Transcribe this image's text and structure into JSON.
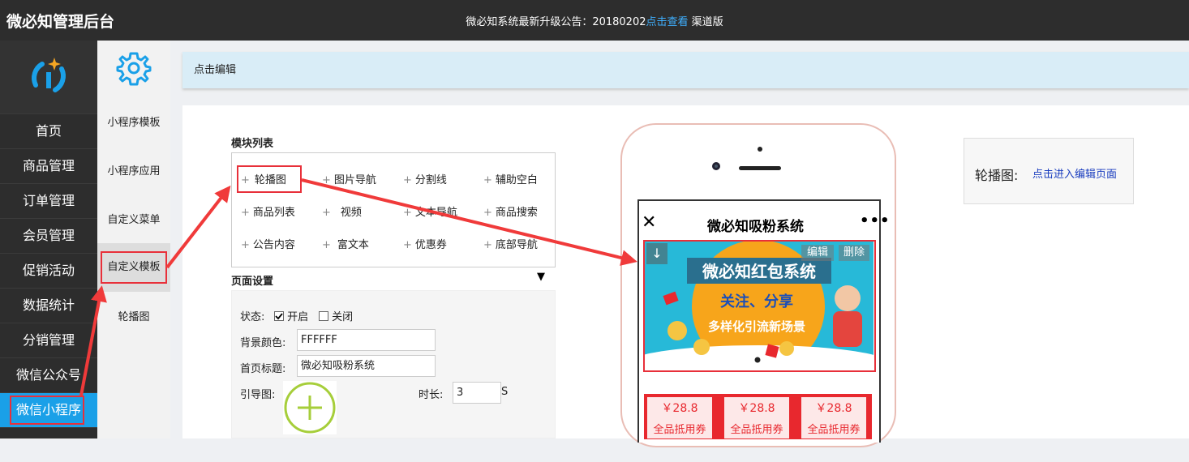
{
  "topbar": {
    "brand": "微必知管理后台",
    "notice_prefix": "微必知系统最新升级公告：20180202",
    "notice_link": "点击查看",
    "notice_suffix": " 渠道版"
  },
  "sidebar": {
    "items": [
      {
        "label": "首页"
      },
      {
        "label": "商品管理"
      },
      {
        "label": "订单管理"
      },
      {
        "label": "会员管理"
      },
      {
        "label": "促销活动"
      },
      {
        "label": "数据统计"
      },
      {
        "label": "分销管理"
      },
      {
        "label": "微信公众号"
      },
      {
        "label": "微信小程序"
      }
    ]
  },
  "subnav": {
    "items": [
      {
        "label": "小程序模板"
      },
      {
        "label": "小程序应用"
      },
      {
        "label": "自定义菜单"
      },
      {
        "label": "自定义模板"
      },
      {
        "label": "轮播图"
      }
    ]
  },
  "hint": "点击编辑",
  "modules": {
    "title": "模块列表",
    "items": [
      {
        "label": "轮播图"
      },
      {
        "label": "图片导航"
      },
      {
        "label": "分割线"
      },
      {
        "label": "辅助空白"
      },
      {
        "label": "商品列表"
      },
      {
        "label": "视频"
      },
      {
        "label": "文本导航"
      },
      {
        "label": "商品搜索"
      },
      {
        "label": "公告内容"
      },
      {
        "label": "富文本"
      },
      {
        "label": "优惠券"
      },
      {
        "label": "底部导航"
      }
    ]
  },
  "page_settings": {
    "title": "页面设置",
    "status_label": "状态:",
    "status_on": "开启",
    "status_off": "关闭",
    "bg_color_label": "背景颜色:",
    "bg_color_value": "FFFFFF",
    "home_title_label": "首页标题:",
    "home_title_value": "微必知吸粉系统",
    "guide_label": "引导图:",
    "duration_label": "时长:",
    "duration_value": "3",
    "duration_unit": "S"
  },
  "preview": {
    "nav_title": "微必知吸粉系统",
    "edit": "编辑",
    "delete": "删除",
    "banner_line1": "微必知红包系统",
    "banner_line2": "关注、分享",
    "banner_line3": "多样化引流新场景",
    "coupons": [
      {
        "price": "￥28.8",
        "name": "全品抵用券"
      },
      {
        "price": "￥28.8",
        "name": "全品抵用券"
      },
      {
        "price": "￥28.8",
        "name": "全品抵用券"
      }
    ]
  },
  "right_card": {
    "key": "轮播图:",
    "link": "点击进入编辑页面"
  },
  "colors": {
    "accent": "#1aa0e8",
    "highlight": "#e8303a",
    "hint_bg": "#d9edf7"
  }
}
